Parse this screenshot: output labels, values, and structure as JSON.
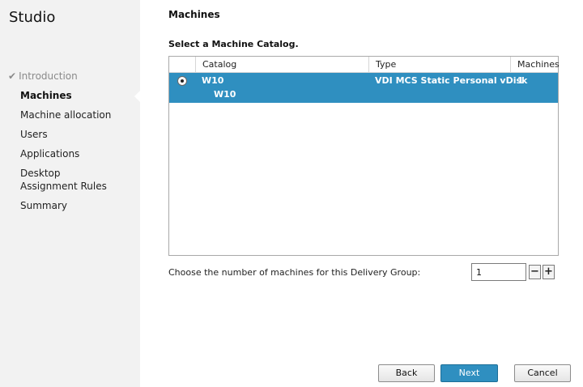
{
  "app": {
    "brand": "Studio"
  },
  "sidebar": {
    "items": [
      {
        "label": "Introduction",
        "state": "completed",
        "icon": "check-icon"
      },
      {
        "label": "Machines",
        "state": "active"
      },
      {
        "label": "Machine allocation",
        "state": "pending"
      },
      {
        "label": "Users",
        "state": "pending"
      },
      {
        "label": "Applications",
        "state": "pending"
      },
      {
        "label": "Desktop Assignment Rules",
        "state": "pending"
      },
      {
        "label": "Summary",
        "state": "pending"
      }
    ]
  },
  "main": {
    "title": "Machines",
    "subtitle": "Select a Machine Catalog.",
    "table": {
      "headers": [
        "Catalog",
        "Type",
        "Machines"
      ],
      "rows": [
        {
          "selected": true,
          "catalog": "W10",
          "sub": "W10",
          "type": "VDI MCS Static Personal vDisk",
          "machines": "1"
        }
      ]
    },
    "count_label": "Choose the number of machines for this Delivery Group:",
    "count_value": "1",
    "minus": "−",
    "plus": "+"
  },
  "footer": {
    "back": "Back",
    "next": "Next",
    "cancel": "Cancel"
  },
  "colors": {
    "accent": "#2f8fc0",
    "sidebar_bg": "#f2f2f2"
  }
}
